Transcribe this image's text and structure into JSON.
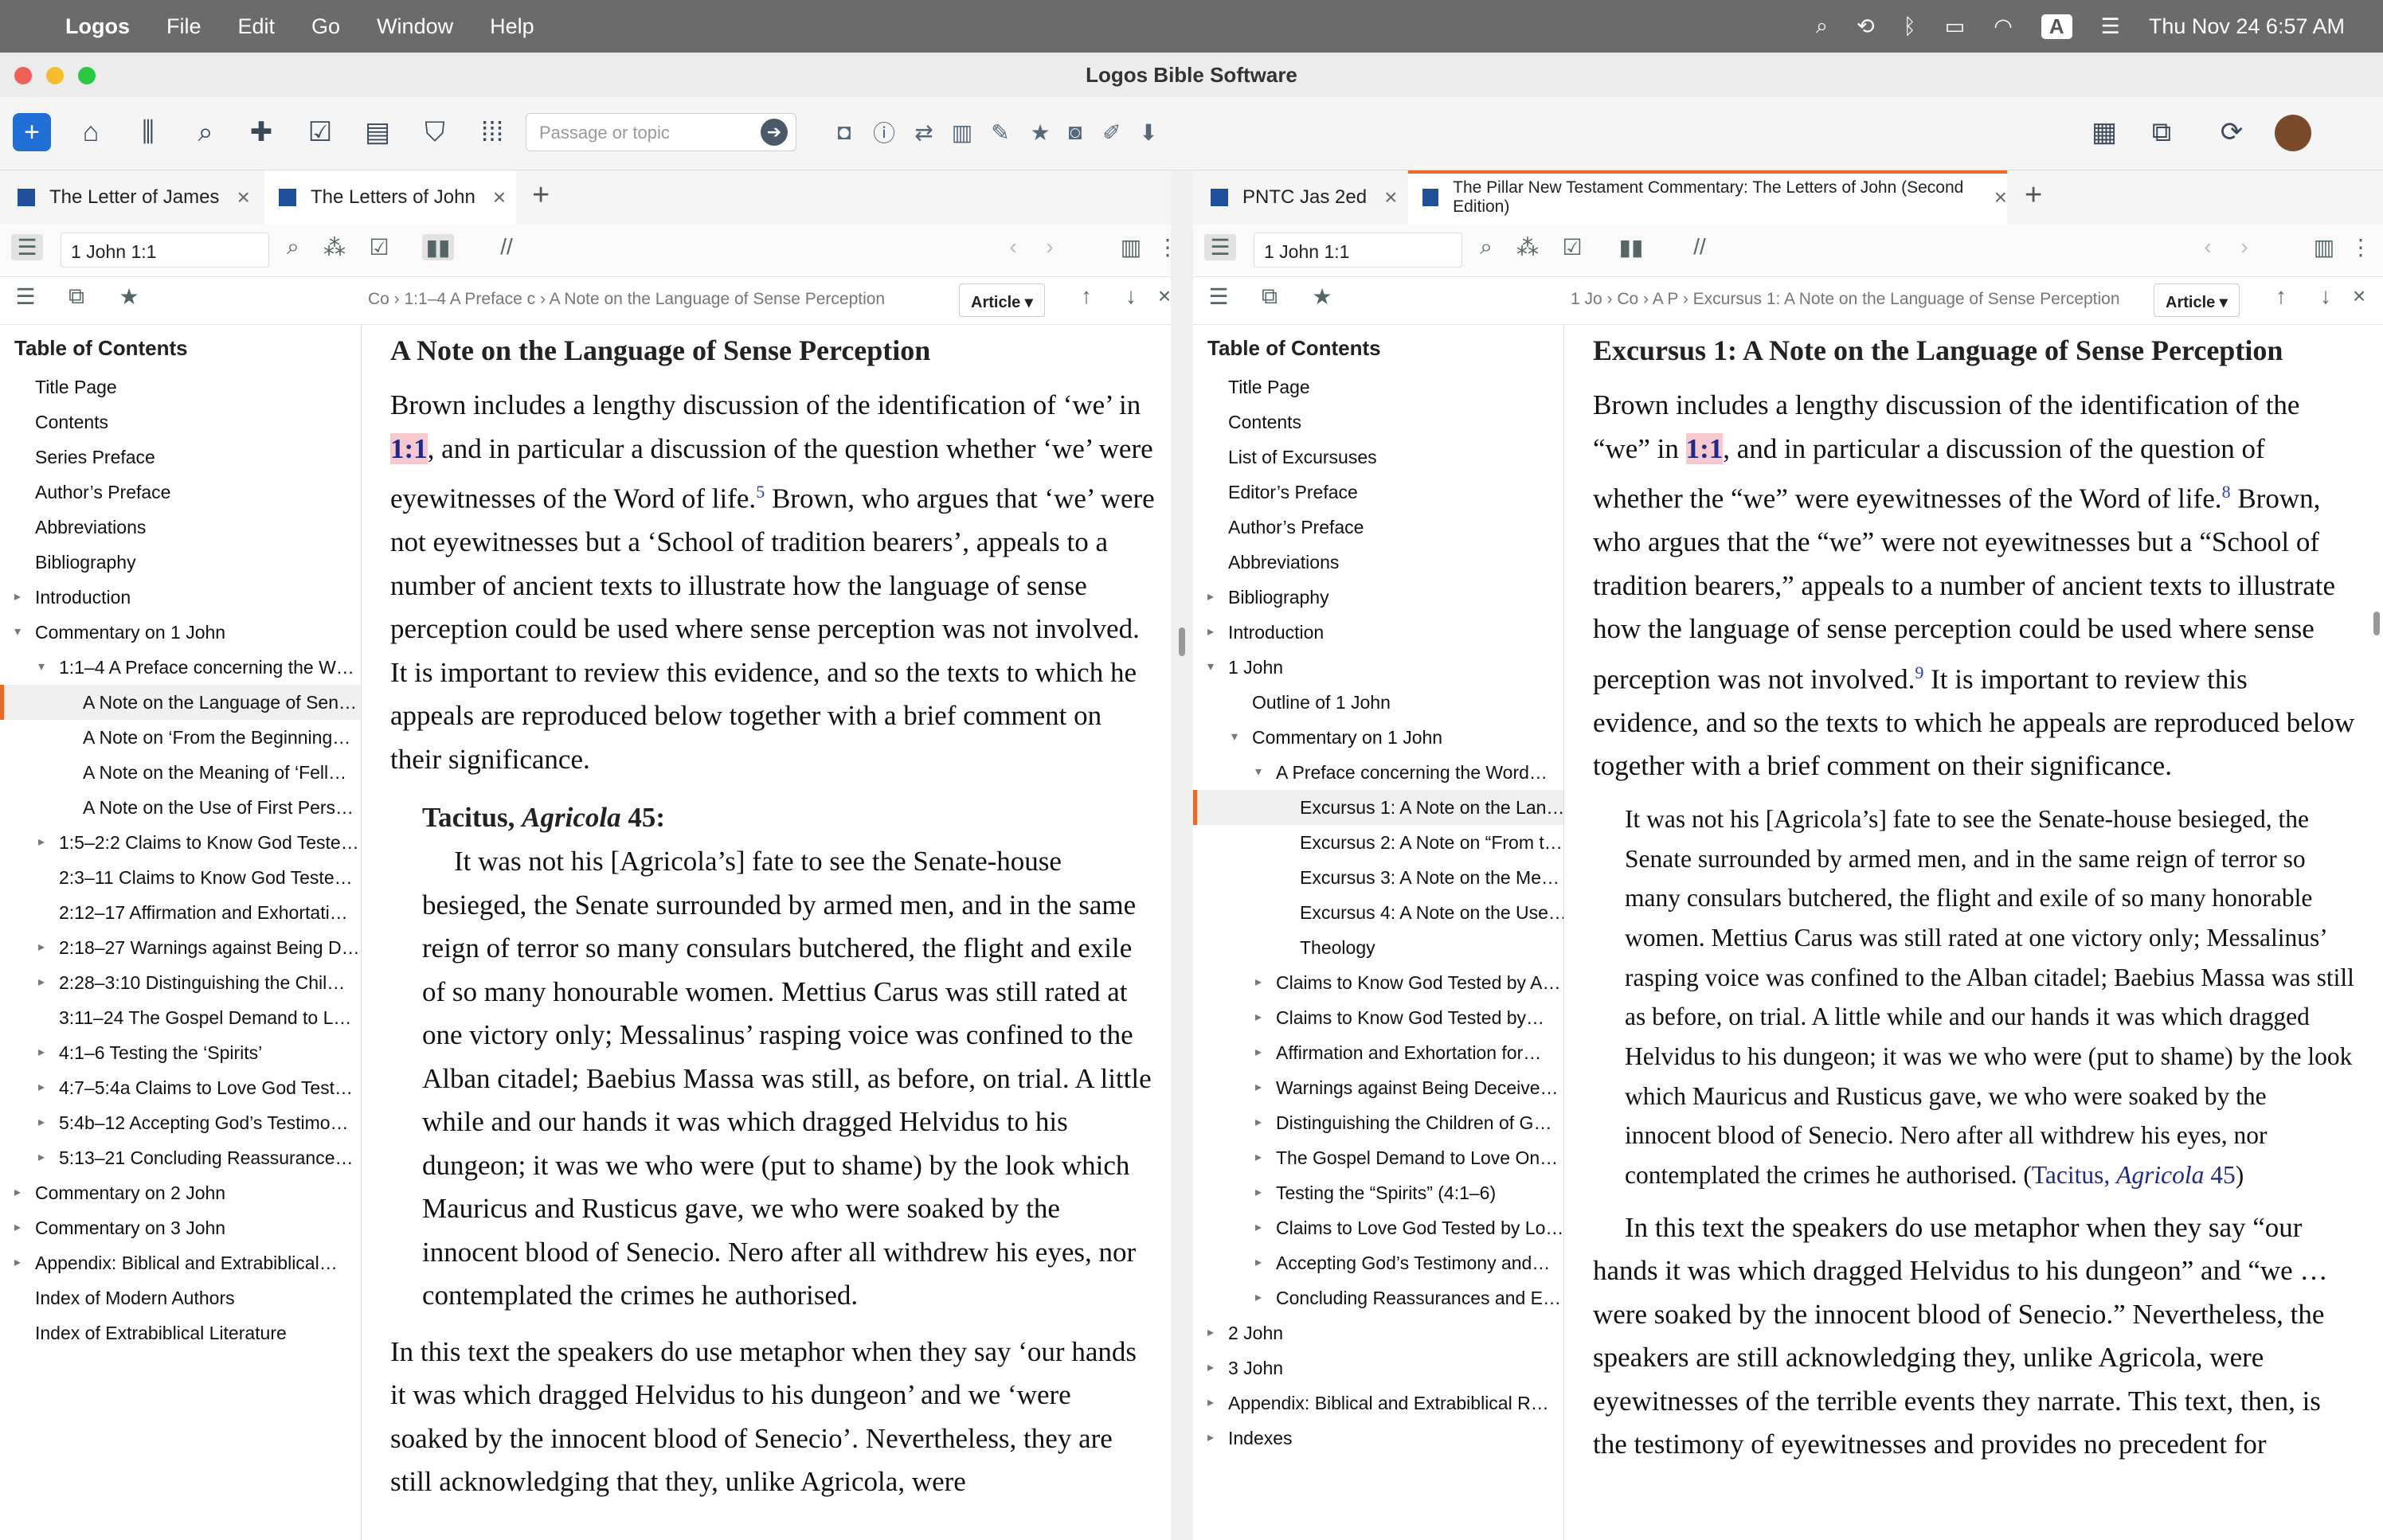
{
  "menubar": {
    "app": "Logos",
    "items": [
      "File",
      "Edit",
      "Go",
      "Window",
      "Help"
    ],
    "clock": "Thu Nov 24  6:57 AM",
    "input_badge": "A"
  },
  "window": {
    "title": "Logos Bible Software"
  },
  "toolbar": {
    "passage_placeholder": "Passage or topic"
  },
  "left": {
    "tabs": [
      {
        "label": "The Letter of James"
      },
      {
        "label": "The Letters of John"
      }
    ],
    "reference": "1 John 1:1",
    "crumb": "Co › 1:1–4 A Preface c › A Note on the Language of Sense Perception",
    "view": "Article",
    "toc_title": "Table of Contents",
    "toc": [
      {
        "label": "Title Page",
        "lvl": 0
      },
      {
        "label": "Contents",
        "lvl": 0
      },
      {
        "label": "Series Preface",
        "lvl": 0
      },
      {
        "label": "Author’s Preface",
        "lvl": 0
      },
      {
        "label": "Abbreviations",
        "lvl": 0
      },
      {
        "label": "Bibliography",
        "lvl": 0
      },
      {
        "label": "Introduction",
        "lvl": 0,
        "arrow": "▸"
      },
      {
        "label": "Commentary on 1 John",
        "lvl": 0,
        "arrow": "▾"
      },
      {
        "label": "1:1–4 A Preface concerning the W…",
        "lvl": 1,
        "arrow": "▾"
      },
      {
        "label": "A Note on the Language of Sen…",
        "lvl": 2,
        "sel": true
      },
      {
        "label": "A Note on ‘From the Beginning…",
        "lvl": 2
      },
      {
        "label": "A Note on the Meaning of ‘Fell…",
        "lvl": 2
      },
      {
        "label": "A Note on the Use of First Pers…",
        "lvl": 2
      },
      {
        "label": "1:5–2:2 Claims to Know God Teste…",
        "lvl": 1,
        "arrow": "▸"
      },
      {
        "label": "2:3–11 Claims to Know God Teste…",
        "lvl": 1
      },
      {
        "label": "2:12–17 Affirmation and Exhortati…",
        "lvl": 1
      },
      {
        "label": "2:18–27 Warnings against Being D…",
        "lvl": 1,
        "arrow": "▸"
      },
      {
        "label": "2:28–3:10 Distinguishing the Chil…",
        "lvl": 1,
        "arrow": "▸"
      },
      {
        "label": "3:11–24 The Gospel Demand to L…",
        "lvl": 1
      },
      {
        "label": "4:1–6 Testing the ‘Spirits’",
        "lvl": 1,
        "arrow": "▸"
      },
      {
        "label": "4:7–5:4a Claims to Love God Test…",
        "lvl": 1,
        "arrow": "▸"
      },
      {
        "label": "5:4b–12 Accepting God’s Testimo…",
        "lvl": 1,
        "arrow": "▸"
      },
      {
        "label": "5:13–21 Concluding Reassurance…",
        "lvl": 1,
        "arrow": "▸"
      },
      {
        "label": "Commentary on 2 John",
        "lvl": 0,
        "arrow": "▸"
      },
      {
        "label": "Commentary on 3 John",
        "lvl": 0,
        "arrow": "▸"
      },
      {
        "label": "Appendix: Biblical and Extrabiblical…",
        "lvl": 0,
        "arrow": "▸"
      },
      {
        "label": "Index of Modern Authors",
        "lvl": 0
      },
      {
        "label": "Index of Extrabiblical Literature",
        "lvl": 0
      }
    ],
    "heading": "A Note on the Language of Sense Perception",
    "p1a": "Brown includes a lengthy discussion of the identification of ‘we’ in ",
    "p1hl": "1:1",
    "p1b": ", and in particular a discussion of the question whether ‘we’ were eyewitnesses of the Word of life.",
    "p1fn": "5",
    "p1c": " Brown, who argues that ‘we’ were not eyewitnesses but a ‘School of tradition bearers’, appeals to a number of ancient texts to illustrate how the language of sense perception could be used where sense perception was not involved. It is important to review this evidence, and so the texts to which he appeals are reproduced below together with a brief comment on their significance.",
    "qhead_a": "Tacitus, ",
    "qhead_b": "Agricola",
    "qhead_c": " 45:",
    "quote": "It was not his [Agricola’s] fate to see the Senate-house besieged, the Senate surrounded by armed men, and in the same reign of terror so many consulars butchered, the flight and exile of so many honourable women. Mettius Carus was still rated at one victory only; Messalinus’ rasping voice was confined to the Alban citadel; Baebius Massa was still, as before, on trial. A little while and our hands it was which dragged Helvidus to his dungeon; it was we who were (put to shame) by the look which Mauricus and Rusticus gave, we who were soaked by the innocent blood of Senecio. Nero after all withdrew his eyes, nor contemplated the crimes he authorised.",
    "p2": "In this text the speakers do use metaphor when they say ‘our hands it was which dragged Helvidus to his dungeon’ and we ‘were soaked by the innocent blood of Senecio’. Nevertheless, they are still acknowledging that they, unlike Agricola, were"
  },
  "right": {
    "tabs": [
      {
        "label": "PNTC Jas 2ed"
      },
      {
        "label": "The Pillar New Testament Commentary: The Letters of John (Second Edition)"
      }
    ],
    "reference": "1 John 1:1",
    "crumb": "1 Jo › Co › A P › Excursus 1: A Note on the Language of Sense Perception",
    "view": "Article",
    "toc_title": "Table of Contents",
    "toc": [
      {
        "label": "Title Page",
        "lvl": 0
      },
      {
        "label": "Contents",
        "lvl": 0
      },
      {
        "label": "List of Excursuses",
        "lvl": 0
      },
      {
        "label": "Editor’s Preface",
        "lvl": 0
      },
      {
        "label": "Author’s Preface",
        "lvl": 0
      },
      {
        "label": "Abbreviations",
        "lvl": 0
      },
      {
        "label": "Bibliography",
        "lvl": 0,
        "arrow": "▸"
      },
      {
        "label": "Introduction",
        "lvl": 0,
        "arrow": "▸"
      },
      {
        "label": "1 John",
        "lvl": 0,
        "arrow": "▾"
      },
      {
        "label": "Outline of 1 John",
        "lvl": 1
      },
      {
        "label": "Commentary on 1 John",
        "lvl": 1,
        "arrow": "▾"
      },
      {
        "label": "A Preface concerning the Word…",
        "lvl": 2,
        "arrow": "▾"
      },
      {
        "label": "Excursus 1: A Note on the Lan…",
        "lvl": 3,
        "sel": true
      },
      {
        "label": "Excursus 2: A Note on “From t…",
        "lvl": 3
      },
      {
        "label": "Excursus 3: A Note on the Me…",
        "lvl": 3
      },
      {
        "label": "Excursus 4: A Note on the Use…",
        "lvl": 3
      },
      {
        "label": "Theology",
        "lvl": 3
      },
      {
        "label": "Claims to Know God Tested by A…",
        "lvl": 2,
        "arrow": "▸"
      },
      {
        "label": "Claims to Know God Tested by…",
        "lvl": 2,
        "arrow": "▸"
      },
      {
        "label": "Affirmation and Exhortation for…",
        "lvl": 2,
        "arrow": "▸"
      },
      {
        "label": "Warnings against Being Deceive…",
        "lvl": 2,
        "arrow": "▸"
      },
      {
        "label": "Distinguishing the Children of G…",
        "lvl": 2,
        "arrow": "▸"
      },
      {
        "label": "The Gospel Demand to Love On…",
        "lvl": 2,
        "arrow": "▸"
      },
      {
        "label": "Testing the “Spirits” (4:1–6)",
        "lvl": 2,
        "arrow": "▸"
      },
      {
        "label": "Claims to Love God Tested by Lo…",
        "lvl": 2,
        "arrow": "▸"
      },
      {
        "label": "Accepting God’s Testimony and…",
        "lvl": 2,
        "arrow": "▸"
      },
      {
        "label": "Concluding Reassurances and E…",
        "lvl": 2,
        "arrow": "▸"
      },
      {
        "label": "2 John",
        "lvl": 0,
        "arrow": "▸"
      },
      {
        "label": "3 John",
        "lvl": 0,
        "arrow": "▸"
      },
      {
        "label": "Appendix: Biblical and Extrabiblical R…",
        "lvl": 0,
        "arrow": "▸"
      },
      {
        "label": "Indexes",
        "lvl": 0,
        "arrow": "▸"
      }
    ],
    "heading": "Excursus 1: A Note on the Language of Sense Perception",
    "p1a": "Brown includes a lengthy discussion of the identification of the “we” in ",
    "p1hl": "1:1",
    "p1b": ", and in particular a discussion of the question of whether the “we” were eyewitnesses of the Word of life.",
    "p1fn": "8",
    "p1c": " Brown, who argues that the “we” were not eyewitnesses but a “School of tradition bearers,” appeals to a number of ancient texts to illustrate how the language of sense perception could be used where sense perception was not involved.",
    "p1fn2": "9",
    "p1d": " It is important to review this evidence, and so the texts to which he appeals are reproduced below together with a brief comment on their significance.",
    "quote": "It was not his [Agricola’s] fate to see the Senate-house besieged, the Senate surrounded by armed men, and in the same reign of terror so many consulars butchered, the flight and exile of so many honorable women. Mettius Carus was still rated at one victory only; Messalinus’ rasping voice was confined to the Alban citadel; Baebius Massa was still as before, on trial. A little while and our hands it was which dragged Helvidus to his dungeon; it was we who were (put to shame) by the look which Mauricus and Rusticus gave, we who were soaked by the innocent blood of Senecio. Nero after all withdrew his eyes, nor contemplated the crimes he authorised. ",
    "qref_a": "(",
    "qref_b": "Tacitus, ",
    "qref_c": "Agricola",
    "qref_d": " 45",
    ")": ")",
    "p2": "In this text the speakers do use metaphor when they say “our hands it was which dragged Helvidus to his dungeon” and “we … were soaked by the innocent blood of Senecio.” Nevertheless, the speakers are still acknowledging they, unlike Agricola, were eyewitnesses of the terrible events they narrate. This text, then, is the testimony of eyewitnesses and provides no precedent for"
  },
  "colors": {
    "accent": "#e8692a",
    "highlight": "#f7c9cf",
    "link": "#1c2a8c"
  }
}
